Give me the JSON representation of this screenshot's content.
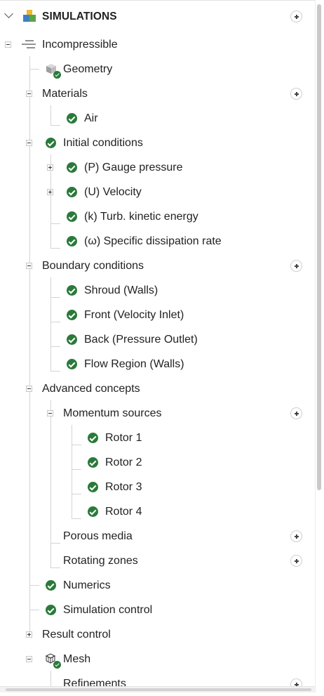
{
  "header": {
    "title": "SIMULATIONS",
    "icons": {
      "collapse": "chevron-down-icon",
      "logo": "simulations-cubes-icon",
      "add": "plus-circle-icon"
    }
  },
  "simulation": {
    "name": "Incompressible",
    "icon": "simulation-type-icon",
    "geometry": "Geometry",
    "materials": {
      "label": "Materials",
      "items": [
        "Air"
      ]
    },
    "initial_conditions": {
      "label": "Initial conditions",
      "items": [
        "(P) Gauge pressure",
        "(U) Velocity",
        "(k) Turb. kinetic energy",
        "(ω) Specific dissipation rate"
      ]
    },
    "boundary_conditions": {
      "label": "Boundary conditions",
      "items": [
        "Shroud (Walls)",
        "Front (Velocity Inlet)",
        "Back (Pressure Outlet)",
        "Flow Region (Walls)"
      ]
    },
    "advanced_concepts": {
      "label": "Advanced concepts",
      "momentum_sources": {
        "label": "Momentum sources",
        "items": [
          "Rotor 1",
          "Rotor 2",
          "Rotor 3",
          "Rotor 4"
        ]
      },
      "porous_media": "Porous media",
      "rotating_zones": "Rotating zones"
    },
    "numerics": "Numerics",
    "simulation_control": "Simulation control",
    "result_control": "Result control",
    "mesh": {
      "label": "Mesh",
      "refinements": "Refinements"
    }
  },
  "colors": {
    "status_ok": "#2a7a3a",
    "logo_blue": "#3f7fc4",
    "logo_yellow": "#f2b72a",
    "logo_green": "#5aa646"
  }
}
